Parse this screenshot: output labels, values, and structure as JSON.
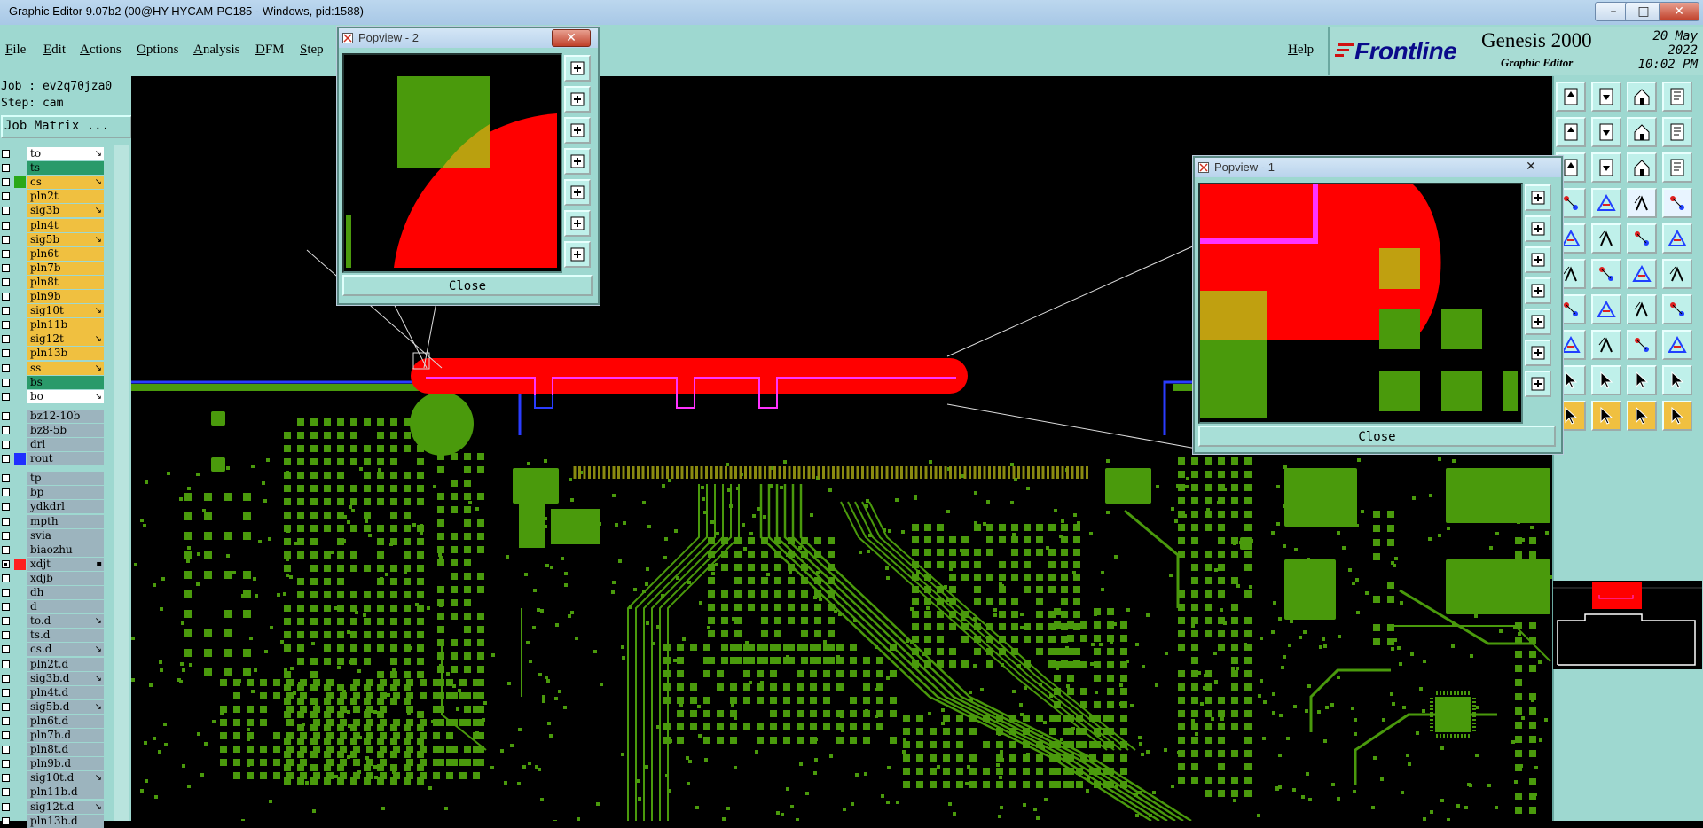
{
  "window": {
    "title": "Graphic Editor 9.07b2 (00@HY-HYCAM-PC185 - Windows, pid:1588)",
    "minimize_label": "–",
    "maximize_label": "□",
    "close_label": "✕"
  },
  "menu": {
    "items": [
      "File",
      "Edit",
      "Actions",
      "Options",
      "Analysis",
      "DFM",
      "Step"
    ],
    "help": "Help"
  },
  "brand": {
    "logo": "Frontline",
    "product": "Genesis 2000",
    "subtitle": "Graphic Editor",
    "date": "20 May 2022",
    "time": "10:02 PM"
  },
  "info": {
    "job": "Job : ev2q70jza0",
    "step": "Step: cam",
    "job_matrix": "Job Matrix ..."
  },
  "colors": {
    "panel": "#9ed8d0",
    "board_copper": "#4a9a0c",
    "highlight_red": "#ff0000",
    "outline_magenta": "#ff33ff",
    "outline_blue": "#2a3cff",
    "layer_green": "#2a9a6a",
    "layer_yellow": "#f0c040",
    "layer_grey": "#9cb4be",
    "layer_white": "#ffffff"
  },
  "layers": [
    {
      "name": "to",
      "color": "white",
      "mark": "↘"
    },
    {
      "name": "ts",
      "color": "green",
      "mark": ""
    },
    {
      "name": "cs",
      "color": "yellow",
      "mark": "↘",
      "swatch": "#2aa818"
    },
    {
      "name": "pln2t",
      "color": "yellow",
      "mark": ""
    },
    {
      "name": "sig3b",
      "color": "yellow",
      "mark": "↘"
    },
    {
      "name": "pln4t",
      "color": "yellow",
      "mark": ""
    },
    {
      "name": "sig5b",
      "color": "yellow",
      "mark": "↘"
    },
    {
      "name": "pln6t",
      "color": "yellow",
      "mark": ""
    },
    {
      "name": "pln7b",
      "color": "yellow",
      "mark": ""
    },
    {
      "name": "pln8t",
      "color": "yellow",
      "mark": ""
    },
    {
      "name": "pln9b",
      "color": "yellow",
      "mark": ""
    },
    {
      "name": "sig10t",
      "color": "yellow",
      "mark": "↘"
    },
    {
      "name": "pln11b",
      "color": "yellow",
      "mark": ""
    },
    {
      "name": "sig12t",
      "color": "yellow",
      "mark": "↘"
    },
    {
      "name": "pln13b",
      "color": "yellow",
      "mark": ""
    },
    {
      "name": "ss",
      "color": "yellow",
      "mark": "↘"
    },
    {
      "name": "bs",
      "color": "green",
      "mark": ""
    },
    {
      "name": "bo",
      "color": "white",
      "mark": "↘"
    },
    {
      "gap": true
    },
    {
      "name": "bz12-10b",
      "color": "grey",
      "mark": ""
    },
    {
      "name": "bz8-5b",
      "color": "grey",
      "mark": ""
    },
    {
      "name": "drl",
      "color": "grey",
      "mark": ""
    },
    {
      "name": "rout",
      "color": "grey",
      "mark": "",
      "swatch": "#2030ff"
    },
    {
      "gap": true
    },
    {
      "name": "tp",
      "color": "grey",
      "mark": ""
    },
    {
      "name": "bp",
      "color": "grey",
      "mark": ""
    },
    {
      "name": "ydkdrl",
      "color": "grey",
      "mark": ""
    },
    {
      "name": "mpth",
      "color": "grey",
      "mark": ""
    },
    {
      "name": "svia",
      "color": "grey",
      "mark": ""
    },
    {
      "name": "biaozhu",
      "color": "grey",
      "mark": ""
    },
    {
      "name": "xdjt",
      "color": "grey",
      "mark": "▪",
      "swatch": "#ff2020",
      "checked": true
    },
    {
      "name": "xdjb",
      "color": "grey",
      "mark": ""
    },
    {
      "name": "dh",
      "color": "grey",
      "mark": ""
    },
    {
      "name": "d",
      "color": "grey",
      "mark": ""
    },
    {
      "name": "to.d",
      "color": "grey",
      "mark": "↘"
    },
    {
      "name": "ts.d",
      "color": "grey",
      "mark": ""
    },
    {
      "name": "cs.d",
      "color": "grey",
      "mark": "↘"
    },
    {
      "name": "pln2t.d",
      "color": "grey",
      "mark": ""
    },
    {
      "name": "sig3b.d",
      "color": "grey",
      "mark": "↘"
    },
    {
      "name": "pln4t.d",
      "color": "grey",
      "mark": ""
    },
    {
      "name": "sig5b.d",
      "color": "grey",
      "mark": "↘"
    },
    {
      "name": "pln6t.d",
      "color": "grey",
      "mark": ""
    },
    {
      "name": "pln7b.d",
      "color": "grey",
      "mark": ""
    },
    {
      "name": "pln8t.d",
      "color": "grey",
      "mark": ""
    },
    {
      "name": "pln9b.d",
      "color": "grey",
      "mark": ""
    },
    {
      "name": "sig10t.d",
      "color": "grey",
      "mark": "↘"
    },
    {
      "name": "pln11b.d",
      "color": "grey",
      "mark": ""
    },
    {
      "name": "sig12t.d",
      "color": "grey",
      "mark": "↘"
    },
    {
      "name": "pln13b.d",
      "color": "grey",
      "mark": ""
    }
  ],
  "popview2": {
    "title": "Popview - 2",
    "close": "Close"
  },
  "popview1": {
    "title": "Popview - 1",
    "close": "Close"
  },
  "toolbar": {
    "icons": [
      "layer-up-icon",
      "layer-down-icon",
      "home-icon",
      "page-icon",
      "move-left-icon",
      "move-right-icon",
      "snap-icon",
      "flip-icon",
      "refresh-icon",
      "pan-icon",
      "scale-1to1-icon",
      "help-icon",
      "measure-icon",
      "grid-icon",
      "net-red-icon",
      "net-red2-icon",
      "pad-icon",
      "slash-icon",
      "line-icon",
      "circle-icon",
      "node-icon",
      "cross-icon",
      "arc-icon",
      "arc2-icon",
      "slope-icon",
      "diagonal-icon",
      "curve-icon",
      "forbid-icon",
      "split-icon",
      "segment-icon",
      "bracket-icon",
      "shape-icon",
      "tri1-icon",
      "tri2-icon",
      "tri3-icon",
      "tri4-icon",
      "select-icon",
      "select2-icon",
      "select3-icon",
      "select4-icon"
    ]
  }
}
